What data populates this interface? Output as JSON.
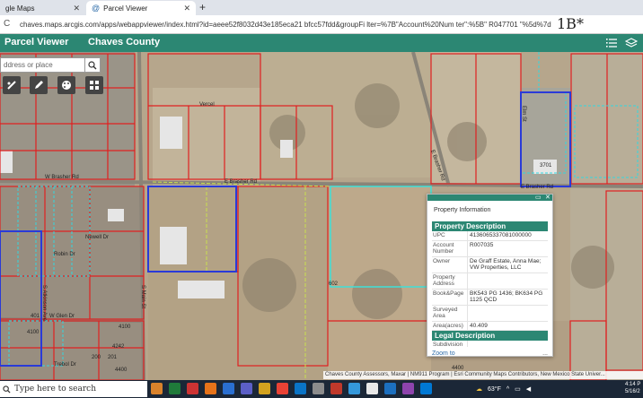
{
  "browser": {
    "tabs": [
      {
        "title": "gle Maps",
        "active": false
      },
      {
        "title": "Parcel Viewer",
        "active": true
      }
    ],
    "new_tab_icon": "plus-icon",
    "url": "chaves.maps.arcgis.com/apps/webappviewer/index.html?id=aeee52f8032d43e185eca21 bfcc57fdd&groupFi lter=%7B\"Account%20Num ter\":%5B\" R047701 \"%5d%7d",
    "extension_label": "1B*"
  },
  "app": {
    "title": "Parcel Viewer",
    "subtitle": "Chaves County",
    "accent": "#2c8773"
  },
  "search": {
    "placeholder": "ddress or place"
  },
  "map": {
    "street_labels": [
      "W Brasher Rd",
      "E Brasher Rd",
      "E Brasher Rd",
      "Newell Dr",
      "Robin Dr",
      "W Glen Dr",
      "Trebol Dr",
      "Vercel",
      "S Main St",
      "S Atkinson Ave",
      "E Brasher Rd",
      "Elm St"
    ],
    "parcel_numbers": [
      "401",
      "4100",
      "4100",
      "4242",
      "200",
      "201",
      "4400",
      "602",
      "4400",
      "3701"
    ],
    "attribution": "Chaves County Assessors, Maxar | NM911 Program | Esri Community Maps Contributors, New Mexico State Univer..."
  },
  "popup": {
    "title": "Property Information",
    "property_section": "Property Description",
    "legal_section": "Legal Description",
    "rows": [
      {
        "key": "UPC",
        "value": "4136065337081000000"
      },
      {
        "key": "Account Number",
        "value": "R007035"
      },
      {
        "key": "Owner",
        "value": "De Graff Estate, Anna Mae; VW Properties, LLC"
      },
      {
        "key": "Property Address",
        "value": ""
      },
      {
        "key": "Book&Page",
        "value": "BK543 PG 1436; BK634 PG 1125 QCD"
      },
      {
        "key": "Surveyed Area",
        "value": ""
      },
      {
        "key": "Area(acres)",
        "value": "40.409"
      }
    ],
    "legal_rows": [
      {
        "key": "Subdivision",
        "value": ""
      },
      {
        "key": "Lot",
        "value": ""
      }
    ],
    "zoom_link": "Zoom to",
    "more": "..."
  },
  "taskbar": {
    "search_placeholder": "Type here to search",
    "weather": "63°F",
    "time": "4:14 P",
    "date": "5/16/2"
  }
}
